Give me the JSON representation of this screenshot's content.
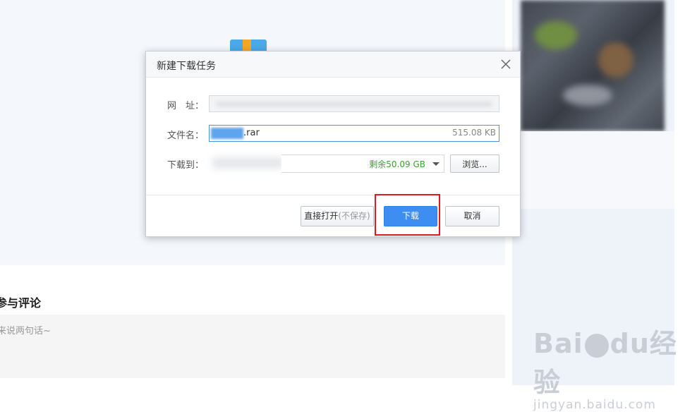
{
  "dialog": {
    "title": "新建下载任务",
    "url_label": "网　址：",
    "filename_label": "文件名：",
    "filename_ext": ".rar",
    "filename_size": "515.08 KB",
    "saveto_label": "下载到：",
    "free_space": "剩余50.09 GB",
    "browse_label": "浏览...",
    "open_label": "直接打开",
    "open_note": "(不保存)",
    "download_label": "下载",
    "cancel_label": "取消"
  },
  "page": {
    "comment_title": "参与评论",
    "comment_placeholder": "来说两句话~"
  },
  "watermark": {
    "brand_left": "Bai",
    "brand_right": "du",
    "brand_cn": "经验",
    "url": "jingyan.baidu.com"
  },
  "colors": {
    "primary_button": "#3d8ef0",
    "highlight": "#e0191f",
    "free_space": "#3aa02f"
  },
  "icons": [
    "close-icon",
    "caret-down-icon",
    "paw-icon"
  ]
}
